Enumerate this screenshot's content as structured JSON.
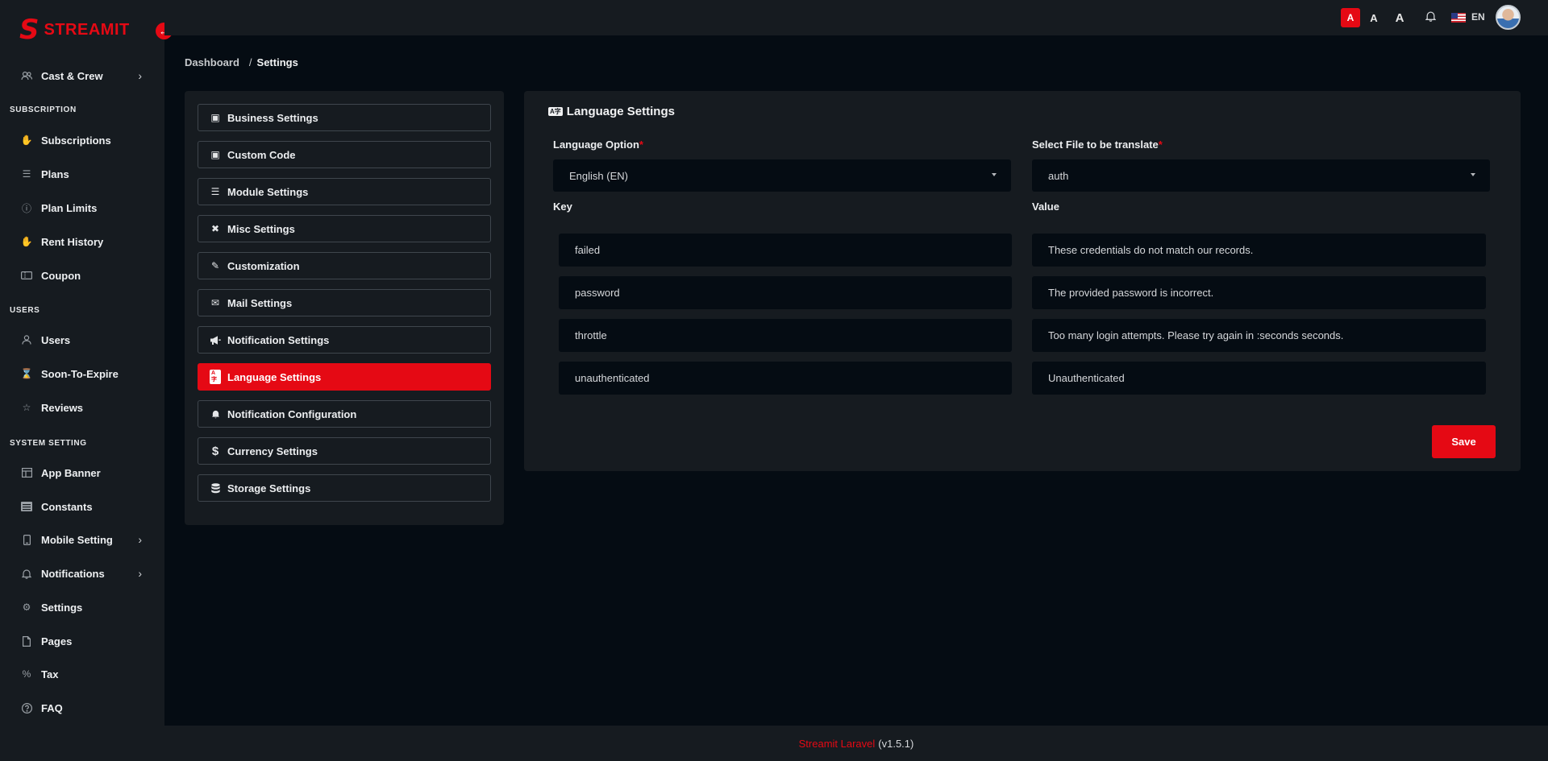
{
  "brand": {
    "logo_letter": "S",
    "name": "STREAMIT",
    "accent": "#e50914"
  },
  "sidebar": {
    "items": [
      {
        "label": "Cast & Crew",
        "icon": "users-icon",
        "has_submenu": true
      },
      {
        "section": "SUBSCRIPTION"
      },
      {
        "label": "Subscriptions",
        "icon": "hand-icon"
      },
      {
        "label": "Plans",
        "icon": "list-icon"
      },
      {
        "label": "Plan Limits",
        "icon": "info-icon"
      },
      {
        "label": "Rent History",
        "icon": "hand-icon"
      },
      {
        "label": "Coupon",
        "icon": "ticket-icon"
      },
      {
        "section": "USERS"
      },
      {
        "label": "Users",
        "icon": "user-icon"
      },
      {
        "label": "Soon-To-Expire",
        "icon": "hourglass-icon"
      },
      {
        "label": "Reviews",
        "icon": "star-icon"
      },
      {
        "section": "SYSTEM SETTING"
      },
      {
        "label": "App Banner",
        "icon": "layout-icon"
      },
      {
        "label": "Constants",
        "icon": "keyboard-icon"
      },
      {
        "label": "Mobile Setting",
        "icon": "phone-icon",
        "has_submenu": true
      },
      {
        "label": "Notifications",
        "icon": "bell-icon",
        "has_submenu": true
      },
      {
        "label": "Settings",
        "icon": "gear-icon"
      },
      {
        "label": "Pages",
        "icon": "page-icon"
      },
      {
        "label": "Tax",
        "icon": "percent-icon"
      },
      {
        "label": "FAQ",
        "icon": "question-icon"
      }
    ]
  },
  "topbar": {
    "font_sizes": [
      "A",
      "A",
      "A"
    ],
    "language": "EN"
  },
  "breadcrumb": {
    "root": "Dashboard",
    "separator": "/",
    "current": "Settings"
  },
  "settings_menu": [
    {
      "label": "Business Settings",
      "icon": "cube-icon"
    },
    {
      "label": "Custom Code",
      "icon": "cube-icon"
    },
    {
      "label": "Module Settings",
      "icon": "list-icon"
    },
    {
      "label": "Misc Settings",
      "icon": "tools-icon"
    },
    {
      "label": "Customization",
      "icon": "paint-icon"
    },
    {
      "label": "Mail Settings",
      "icon": "envelope-icon"
    },
    {
      "label": "Notification Settings",
      "icon": "megaphone-icon"
    },
    {
      "label": "Language Settings",
      "icon": "language-icon",
      "active": true
    },
    {
      "label": "Notification Configuration",
      "icon": "bell-icon"
    },
    {
      "label": "Currency Settings",
      "icon": "dollar-icon"
    },
    {
      "label": "Storage Settings",
      "icon": "database-icon"
    }
  ],
  "language_panel": {
    "title": "Language Settings",
    "language_option_label": "Language Option",
    "language_option_value": "English (EN)",
    "file_label": "Select File to be translate",
    "file_value": "auth",
    "key_header": "Key",
    "value_header": "Value",
    "rows": [
      {
        "key": "failed",
        "value": "These credentials do not match our records."
      },
      {
        "key": "password",
        "value": "The provided password is incorrect."
      },
      {
        "key": "throttle",
        "value": "Too many login attempts. Please try again in :seconds seconds."
      },
      {
        "key": "unauthenticated",
        "value": "Unauthenticated"
      }
    ],
    "save_label": "Save"
  },
  "footer": {
    "link": "Streamit Laravel",
    "version": "(v1.5.1)"
  }
}
